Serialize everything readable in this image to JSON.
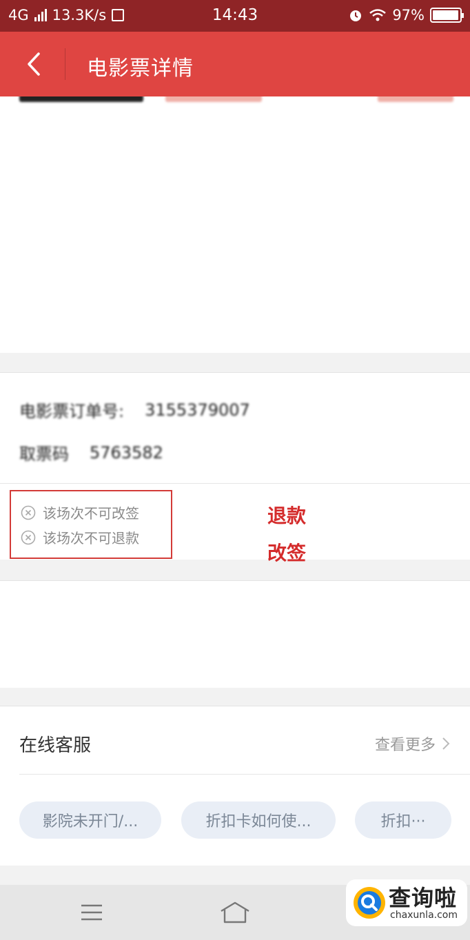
{
  "status_bar": {
    "network": "4G",
    "speed": "13.3K/s",
    "time": "14:43",
    "battery": "97%",
    "battery_level": 0.97
  },
  "header": {
    "title": "电影票详情"
  },
  "order": {
    "ticket_label": "电影票订单号:",
    "ticket_number": "3155379007",
    "code_label": "取票码",
    "code_value": "5763582"
  },
  "policies": [
    {
      "text": "该场次不可改签"
    },
    {
      "text": "该场次不可退款"
    }
  ],
  "annotations": {
    "refund": "退款",
    "change": "改签"
  },
  "customer_service": {
    "title": "在线客服",
    "more_label": "查看更多",
    "chips": [
      "影院未开门/...",
      "折扣卡如何使...",
      "折扣···"
    ]
  },
  "watermark": {
    "brand": "查询啦",
    "url": "chaxunla.com"
  }
}
